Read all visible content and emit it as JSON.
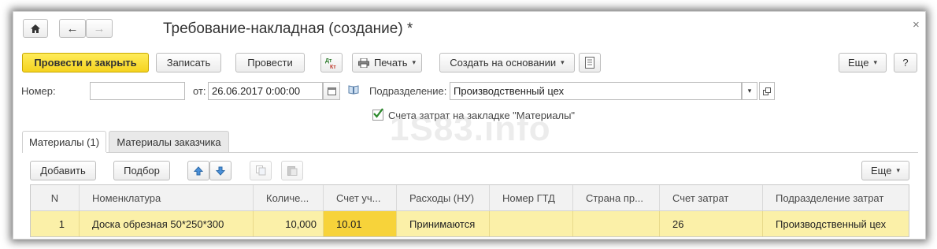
{
  "window": {
    "title": "Требование-накладная (создание) *",
    "close_glyph": "×"
  },
  "nav": {
    "home_icon": "home-icon",
    "back_glyph": "←",
    "forward_glyph": "→"
  },
  "toolbar": {
    "post_close_label": "Провести и закрыть",
    "save_label": "Записать",
    "post_label": "Провести",
    "dt_kt_label": "Дт Кт",
    "print_label": "Печать",
    "create_based_label": "Создать на основании",
    "more_label": "Еще",
    "help_label": "?"
  },
  "form": {
    "number_label": "Номер:",
    "number_value": "",
    "date_label": "от:",
    "date_value": "26.06.2017  0:00:00",
    "department_label": "Подразделение:",
    "department_value": "Производственный цех",
    "cost_accounts_checkbox_label": "Счета затрат на закладке \"Материалы\"",
    "cost_accounts_checked": true
  },
  "watermark": "1S83.info",
  "tabs": [
    {
      "label": "Материалы (1)",
      "active": true
    },
    {
      "label": "Материалы заказчика",
      "active": false
    }
  ],
  "table_toolbar": {
    "add_label": "Добавить",
    "pick_label": "Подбор",
    "more_label": "Еще"
  },
  "table": {
    "columns": [
      "N",
      "Номенклатура",
      "Количе...",
      "Счет уч...",
      "Расходы (НУ)",
      "Номер ГТД",
      "Страна пр...",
      "Счет затрат",
      "Подразделение затрат"
    ],
    "rows": [
      [
        "1",
        "Доска обрезная 50*250*300",
        "10,000",
        "10.01",
        "Принимаются",
        "",
        "",
        "26",
        "Производственный цех"
      ]
    ]
  },
  "colors": {
    "primary_button": "#f5d31f",
    "selected_row": "#fbf0a8",
    "selected_cell": "#f7d33a"
  }
}
